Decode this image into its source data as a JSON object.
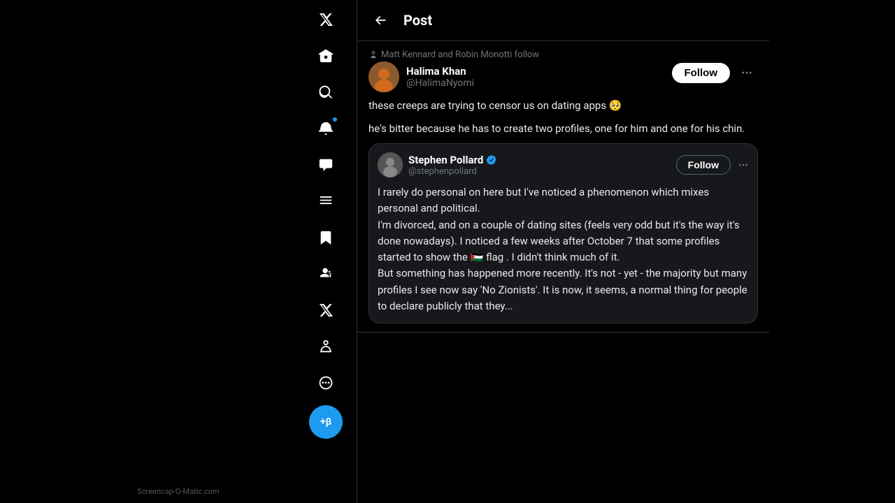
{
  "header": {
    "back_label": "←",
    "title": "Post"
  },
  "sidebar": {
    "items": [
      {
        "name": "x-logo",
        "icon": "x",
        "has_dot": false
      },
      {
        "name": "home",
        "icon": "home",
        "has_dot": false
      },
      {
        "name": "search",
        "icon": "search",
        "has_dot": false
      },
      {
        "name": "notifications",
        "icon": "bell",
        "has_dot": true
      },
      {
        "name": "messages",
        "icon": "envelope",
        "has_dot": false
      },
      {
        "name": "lists",
        "icon": "list",
        "has_dot": false
      },
      {
        "name": "bookmarks",
        "icon": "bookmark",
        "has_dot": false
      },
      {
        "name": "communities",
        "icon": "people",
        "has_dot": false
      },
      {
        "name": "x-icon",
        "icon": "x-small",
        "has_dot": false
      },
      {
        "name": "profile",
        "icon": "person",
        "has_dot": false
      },
      {
        "name": "more",
        "icon": "more-circle",
        "has_dot": false
      }
    ],
    "beta_label": "+β",
    "watermark": "Screencap-O-Matic.com"
  },
  "tweet": {
    "follows_text": "Matt Kennard and Robin Monotti follow",
    "author_name": "Halima Khan",
    "author_handle": "@HalimaNyomi",
    "follow_label": "Follow",
    "tweet_text_line1": "these creeps are trying to censor us on dating apps 🥺",
    "tweet_text_line2": "he's bitter because he has to create two profiles, one for him and one for his chin.",
    "quoted": {
      "author_name": "Stephen Pollard",
      "author_handle": "@stephenpollard",
      "verified": true,
      "follow_label": "Follow",
      "text": "I rarely do personal on here but I've noticed a phenomenon which mixes personal and political.\nI'm divorced, and on a couple of dating sites (feels very odd but it's the way it's done nowadays). I noticed a few weeks after October 7 that some profiles started to show the 🇵🇸 flag . I didn't think much of it.\nBut something has happened more recently. It's not - yet - the majority but many profiles I see now say 'No Zionists'. It is now, it seems, a normal thing for people to declare publicly that they..."
    }
  }
}
